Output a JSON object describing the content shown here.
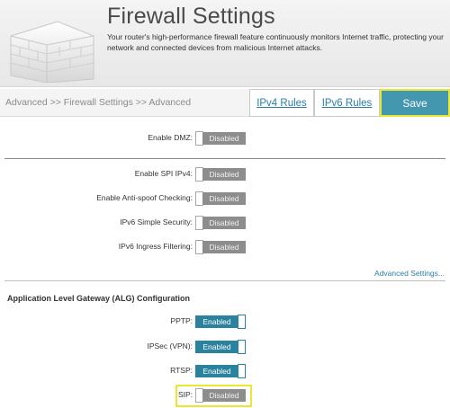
{
  "header": {
    "title": "Firewall Settings",
    "description": "Your router's high-performance firewall feature continuously monitors Internet traffic, protecting your network and connected devices from malicious Internet attacks.",
    "icon": "brick-wall-icon"
  },
  "toolbar": {
    "breadcrumb": "Advanced >> Firewall Settings >> Advanced",
    "ipv4_label": "IPv4 Rules",
    "ipv6_label": "IPv6 Rules",
    "save_label": "Save"
  },
  "settings": {
    "dmz": {
      "label": "Enable DMZ:",
      "state": "Disabled"
    },
    "spi_ipv4": {
      "label": "Enable SPI IPv4:",
      "state": "Disabled"
    },
    "anti_spoof": {
      "label": "Enable Anti-spoof Checking:",
      "state": "Disabled"
    },
    "ipv6_simple": {
      "label": "IPv6 Simple Security:",
      "state": "Disabled"
    },
    "ipv6_ingress": {
      "label": "IPv6 Ingress Filtering:",
      "state": "Disabled"
    }
  },
  "advanced_link": "Advanced Settings...",
  "alg": {
    "title": "Application Level Gateway (ALG) Configuration",
    "pptp": {
      "label": "PPTP:",
      "state": "Enabled"
    },
    "ipsec": {
      "label": "IPSec (VPN):",
      "state": "Enabled"
    },
    "rtsp": {
      "label": "RTSP:",
      "state": "Enabled"
    },
    "sip": {
      "label": "SIP:",
      "state": "Disabled"
    }
  },
  "colors": {
    "accent": "#2a829e",
    "save_bg": "#4397ae",
    "highlight": "#ede534",
    "disabled": "#8d8d8d",
    "link": "#2a7ea6"
  }
}
